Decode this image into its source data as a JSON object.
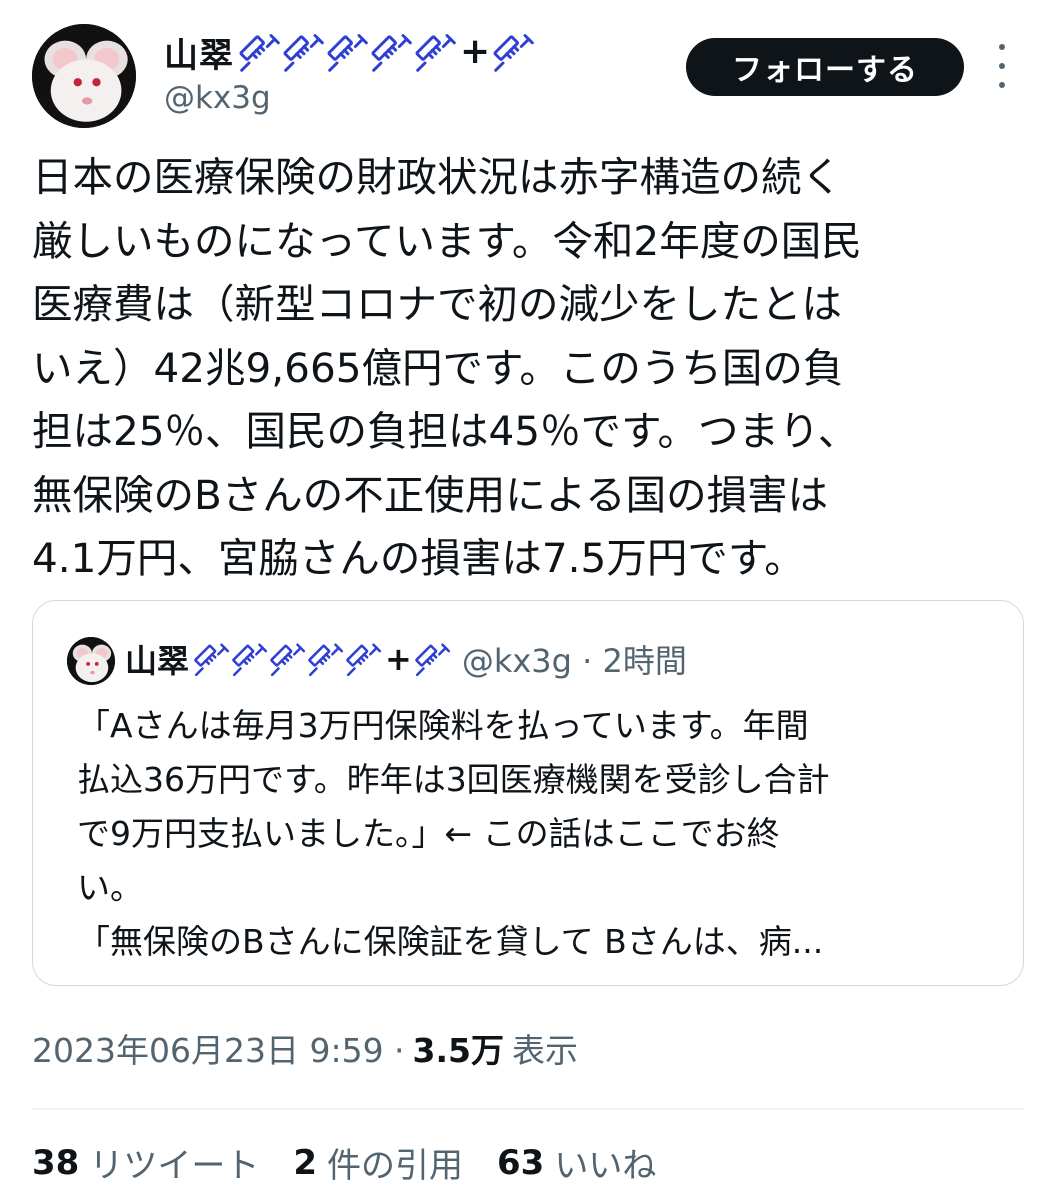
{
  "header": {
    "display_name": "山翠",
    "syringe_count_before_plus": 5,
    "plus": "+",
    "syringe_count_after_plus": 1,
    "handle": "@kx3g",
    "follow_label": "フォローする",
    "emoji_icon": "syringe-icon",
    "avatar_icon": "white-mouse-avatar"
  },
  "tweet": {
    "body": "日本の医療保険の財政状況は赤字構造の続く\n厳しいものになっています。令和2年度の国民\n医療費は（新型コロナで初の減少をしたとは\nいえ）42兆9,665億円です。このうち国の負\n担は25％、国民の負担は45％です。つまり、\n無保険のBさんの不正使用による国の損害は\n4.1万円、宮脇さんの損害は7.5万円です。"
  },
  "quoted": {
    "display_name": "山翠",
    "plus": "+",
    "handle_time": "@kx3g · 2時間",
    "text": "「Aさんは毎月3万円保険料を払っています。年間\n払込36万円です。昨年は3回医療機関を受診し合計\nで9万円支払いました。」← この話はここでお終\nい。\n「無保険のBさんに保険証を貸して Bさんは、病..."
  },
  "meta": {
    "timestamp": "2023年06月23日 9:59 ·",
    "views": "3.5万",
    "views_label": "表示"
  },
  "stats": {
    "retweets_num": "38",
    "retweets_label": "リツイート",
    "quotes_num": "2",
    "quotes_label": "件の引用",
    "likes_num": "63",
    "likes_label": "いいね"
  },
  "colors": {
    "text": "#0f1419",
    "secondary": "#536471",
    "border": "#cfd9de",
    "syringe_blue": "#2f3fd4"
  }
}
